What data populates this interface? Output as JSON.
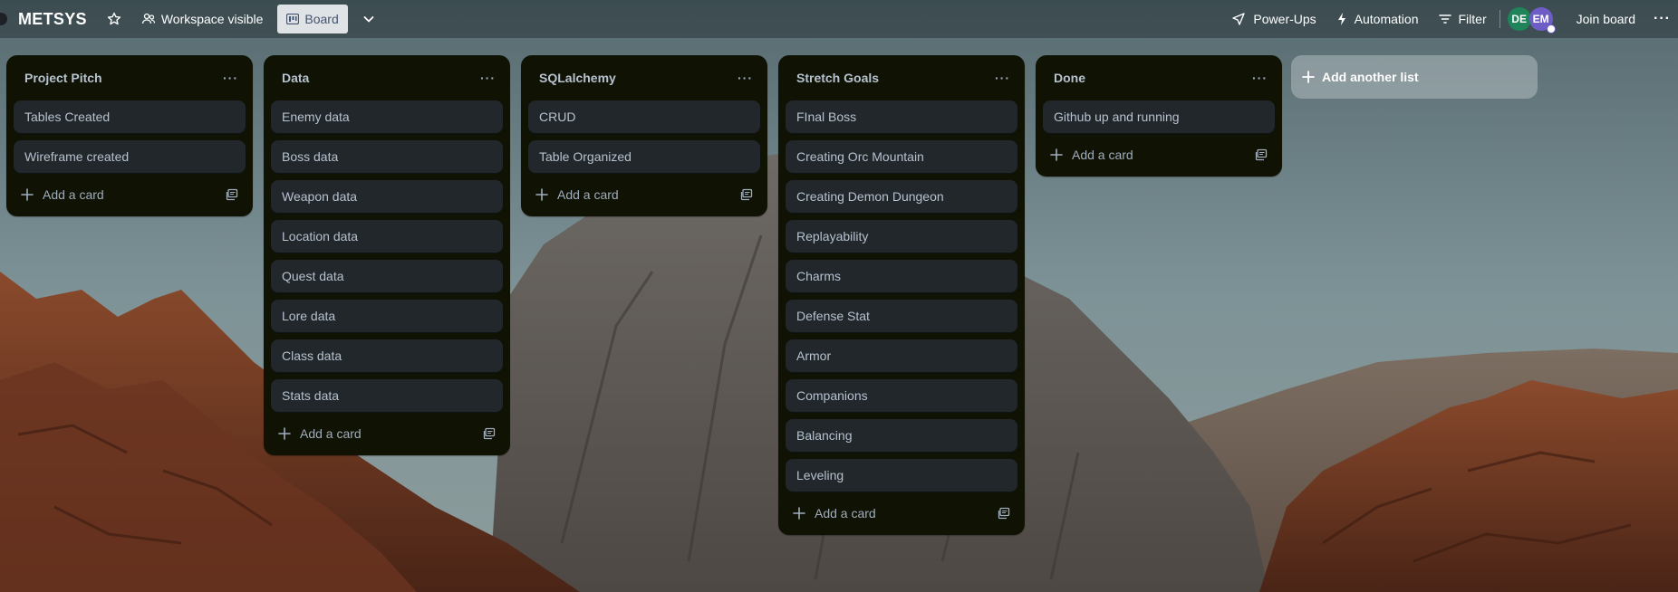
{
  "header": {
    "board_title": "METSYS",
    "workspace_label": "Workspace visible",
    "view_label": "Board",
    "powerups_label": "Power-Ups",
    "automation_label": "Automation",
    "filter_label": "Filter",
    "avatars": [
      "DE",
      "EM"
    ],
    "join_label": "Join board"
  },
  "lists": [
    {
      "title": "Project Pitch",
      "cards": [
        "Tables Created",
        "Wireframe created"
      ]
    },
    {
      "title": "Data",
      "cards": [
        "Enemy data",
        "Boss data",
        "Weapon data",
        "Location data",
        "Quest data",
        "Lore data",
        "Class data",
        "Stats data"
      ]
    },
    {
      "title": "SQLalchemy",
      "cards": [
        "CRUD",
        "Table Organized"
      ]
    },
    {
      "title": "Stretch Goals",
      "cards": [
        "FInal Boss",
        "Creating Orc Mountain",
        "Creating Demon Dungeon",
        "Replayability",
        "Charms",
        "Defense Stat",
        "Armor",
        "Companions",
        "Balancing",
        "Leveling"
      ]
    },
    {
      "title": "Done",
      "cards": [
        "Github up and running"
      ]
    }
  ],
  "add_card_label": "Add a card",
  "add_list_label": "Add another list",
  "colors": {
    "list_bg": "#101204",
    "card_bg": "#22272b",
    "text": "#b6c2cf",
    "avatar_de": "#1f845a",
    "avatar_em": "#6e5dc6"
  }
}
